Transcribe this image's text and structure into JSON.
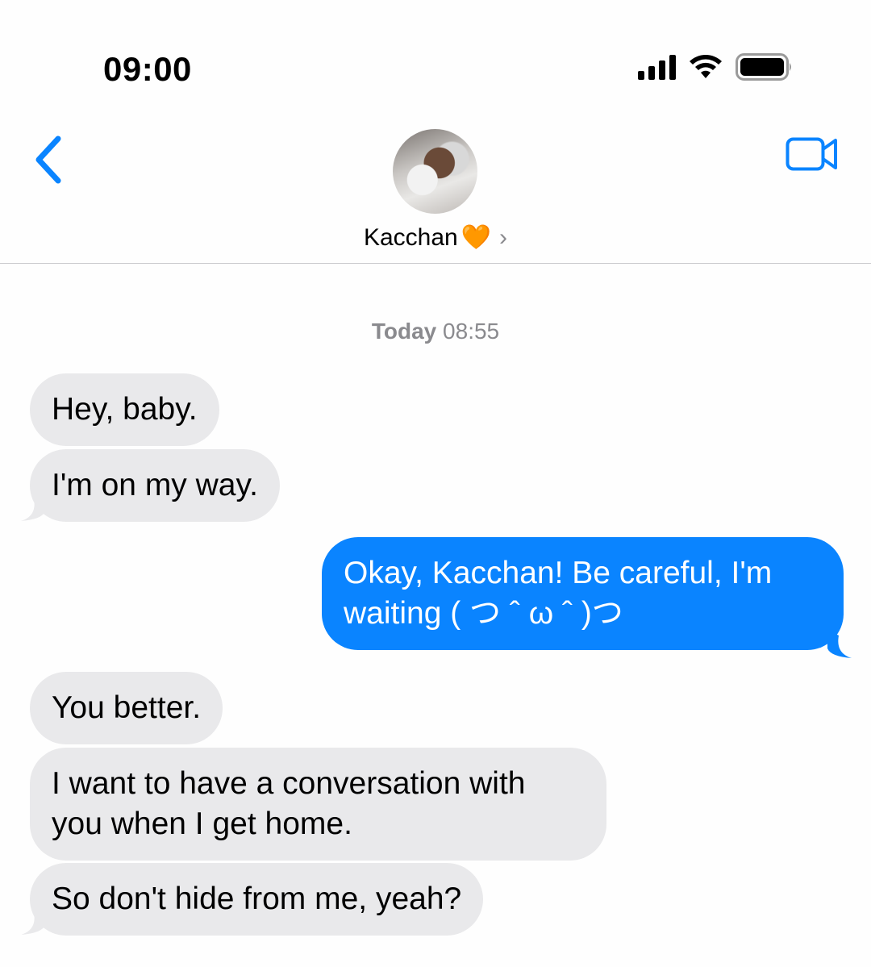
{
  "status_bar": {
    "time": "09:00",
    "icons": [
      "cellular-signal-icon",
      "wifi-icon",
      "battery-icon"
    ]
  },
  "header": {
    "back_icon": "chevron-left-icon",
    "contact_name": "Kacchan",
    "contact_emoji": "🧡",
    "video_icon": "video-camera-icon"
  },
  "conversation": {
    "timestamp_day": "Today",
    "timestamp_time": "08:55",
    "messages": [
      {
        "direction": "incoming",
        "text": "Hey, baby."
      },
      {
        "direction": "incoming",
        "text": "I'm on my way."
      },
      {
        "direction": "outgoing",
        "text": "Okay, Kacchan! Be careful, I'm waiting ( つ ˆ ω ˆ )つ"
      },
      {
        "direction": "incoming",
        "text": "You better."
      },
      {
        "direction": "incoming",
        "text": "I want to have a conversation with you when I get home."
      },
      {
        "direction": "incoming",
        "text": "So don't hide from me, yeah?"
      }
    ]
  },
  "colors": {
    "accent": "#0a84ff",
    "incoming_bubble": "#e9e9eb",
    "secondary_text": "#8a8a8e"
  }
}
